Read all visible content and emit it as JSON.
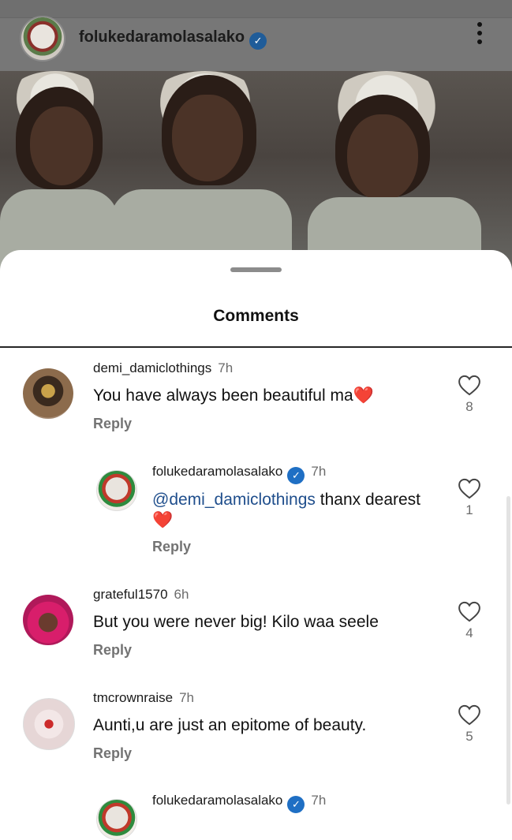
{
  "post": {
    "username": "folukedaramolasalako",
    "verified_glyph": "✓"
  },
  "comments_sheet": {
    "title": "Comments",
    "comments": [
      {
        "username": "demi_damiclothings",
        "time": "7h",
        "text": "You have always been beautiful ma❤️",
        "reply_label": "Reply",
        "likes": "8"
      },
      {
        "username": "folukedaramolasalako",
        "time": "7h",
        "mention": "@demi_damiclothings",
        "text": " thanx dearest",
        "text_line2": "❤️",
        "reply_label": "Reply",
        "likes": "1",
        "verified_glyph": "✓"
      },
      {
        "username": "grateful1570",
        "time": "6h",
        "text": "But you were never big!  Kilo waa seele",
        "reply_label": "Reply",
        "likes": "4"
      },
      {
        "username": "tmcrownraise",
        "time": "7h",
        "text": "Aunti,u are just an epitome of beauty.",
        "reply_label": "Reply",
        "likes": "5"
      },
      {
        "username": "folukedaramolasalako",
        "time": "7h",
        "verified_glyph": "✓"
      }
    ]
  },
  "colors": {
    "accent_blue": "#1f6fc4",
    "mention_blue": "#1f4e8c",
    "heart_red": "#e0245e",
    "muted_text": "#737373"
  }
}
